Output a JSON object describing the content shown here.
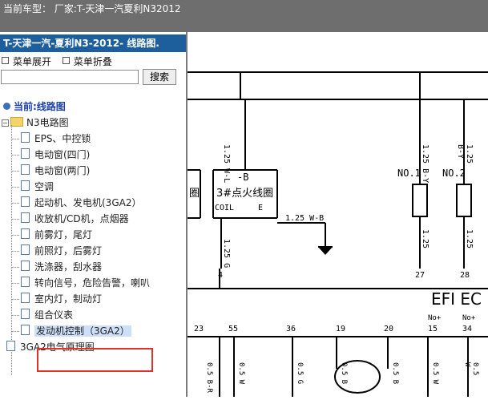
{
  "topbar": {
    "label": "当前车型：  厂家:T-天津一汽夏利N32012"
  },
  "panel": {
    "title": "T-天津一汽-夏利N3-2012- 线路图.",
    "expand_label": "菜单展开",
    "collapse_label": "菜单折叠",
    "search_placeholder": "",
    "search_button": "搜索"
  },
  "tree": {
    "root_label": "当前:线路图",
    "folder_label": "N3电路图",
    "items": [
      "EPS、中控锁",
      "电动窗(四门)",
      "电动窗(两门)",
      "空调",
      "起动机、发电机(3GA2）",
      "收放机/CD机，点烟器",
      "前雾灯，尾灯",
      "前照灯，后雾灯",
      "洗涤器，刮水器",
      "转向信号，危险告警，喇叭",
      "室内灯，制动灯",
      "组合仪表",
      "发动机控制（3GA2）"
    ],
    "bottom_label": "3GA2电气原理图"
  },
  "diagram": {
    "ignition_label_top": "-B",
    "ignition_label": "3#点火线圈",
    "coil_label": "COIL",
    "e_label": "E",
    "left_box_label": "圈",
    "wire_labels": [
      "1.25 W-L",
      "1.25 W-B",
      "1.25 G",
      "1.25 B-Y",
      "1.25 B-Y",
      "1.25",
      "1.25"
    ],
    "injector_labels": [
      "NO.1",
      "NO.2"
    ],
    "efi_label": "EFI EC",
    "pin_numbers_top": [
      "4",
      "27",
      "28"
    ],
    "pin_numbers_bottom": [
      "23",
      "55",
      "36",
      "19",
      "20",
      "15",
      "34"
    ],
    "pin_sub_labels": [
      "No+",
      "No+"
    ],
    "bottom_wire_labels": [
      "0.5 B-R",
      "0.5 W",
      "0.5 G",
      "0.5 B",
      "0.5 B",
      "0.5 W",
      "0.5 W"
    ]
  }
}
